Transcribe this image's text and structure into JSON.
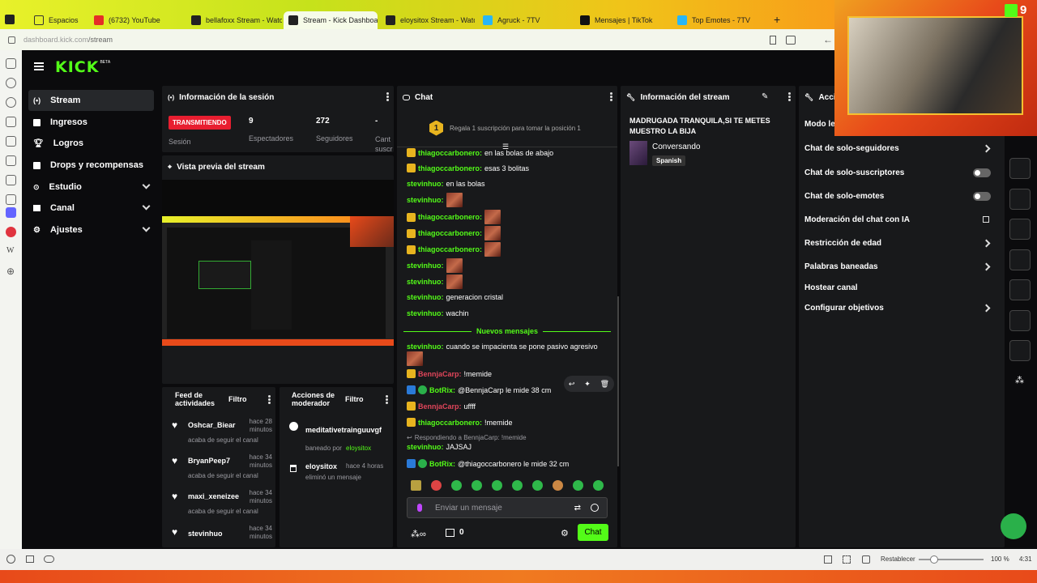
{
  "browser": {
    "tabs": [
      {
        "label": "Espacios"
      },
      {
        "label": "(6732) YouTube"
      },
      {
        "label": "bellafoxx Stream - Watch L"
      },
      {
        "label": "Stream - Kick Dashboard"
      },
      {
        "label": "eloysitox Stream - Watch L"
      },
      {
        "label": "Agruck - 7TV"
      },
      {
        "label": "Mensajes | TikTok"
      },
      {
        "label": "Top Emotes - 7TV"
      }
    ],
    "new_tab": "+",
    "url_domain": "dashboard.kick.com",
    "url_path": "/stream",
    "bottom": {
      "reset_label": "Restablecer",
      "zoom": "100 %",
      "time": "4:31"
    }
  },
  "logo": {
    "text": "KICK",
    "beta": "BETA"
  },
  "nav": [
    {
      "label": "Stream"
    },
    {
      "label": "Ingresos"
    },
    {
      "label": "Logros"
    },
    {
      "label": "Drops y recompensas"
    },
    {
      "label": "Estudio"
    },
    {
      "label": "Canal"
    },
    {
      "label": "Ajustes"
    }
  ],
  "session": {
    "title": "Información de la sesión",
    "status": "TRANSMITIENDO",
    "status_label": "Sesión",
    "viewers": "9",
    "viewers_label": "Espectadores",
    "followers": "272",
    "followers_label": "Seguidores",
    "subs": "-",
    "subs_label": "Cant suscr"
  },
  "preview": {
    "title": "Vista previa del stream"
  },
  "feed": {
    "title": "Feed de actividades",
    "filter": "Filtro",
    "items": [
      {
        "user": "Oshcar_Biear",
        "time": "hace 28 minutos",
        "action": "acaba de seguir el canal"
      },
      {
        "user": "BryanPeep7",
        "time": "hace 34 minutos",
        "action": "acaba de seguir el canal"
      },
      {
        "user": "maxi_xeneizee",
        "time": "hace 34 minutos",
        "action": "acaba de seguir el canal"
      },
      {
        "user": "stevinhuo",
        "time": "hace 34 minutos",
        "action": ""
      }
    ]
  },
  "modactions": {
    "title": "Acciones de moderador",
    "filter": "Filtro",
    "items": [
      {
        "user": "meditativetrainguuvgf",
        "time": "",
        "action": "baneado por",
        "by": "eloysitox"
      },
      {
        "user": "eloysitox",
        "time": "hace 4 horas",
        "action": "eliminó un mensaje",
        "by": ""
      }
    ]
  },
  "chat": {
    "title": "Chat",
    "goal_num": "1",
    "goal_text": "Regala 1 suscripción para tomar la posición 1",
    "messages": [
      {
        "user": "thiagoccarbonero:",
        "text": "en las bolas de abajo"
      },
      {
        "user": "thiagoccarbonero:",
        "text": "esas 3 bolitas"
      },
      {
        "user": "stevinhuo:",
        "text": "en las bolas"
      },
      {
        "user": "stevinhuo:",
        "text": ""
      },
      {
        "user": "thiagoccarbonero:",
        "text": ""
      },
      {
        "user": "thiagoccarbonero:",
        "text": ""
      },
      {
        "user": "thiagoccarbonero:",
        "text": ""
      },
      {
        "user": "stevinhuo:",
        "text": ""
      },
      {
        "user": "stevinhuo:",
        "text": ""
      },
      {
        "user": "stevinhuo:",
        "text": "generacion cristal"
      },
      {
        "user": "stevinhuo:",
        "text": "wachin"
      }
    ],
    "new_messages": "Nuevos mensajes",
    "messages2": [
      {
        "user": "stevinhuo:",
        "text": "cuando se impacienta se pone pasivo agresivo"
      },
      {
        "user": "BennjaCarp:",
        "text": "!memide"
      },
      {
        "user": "BotRix:",
        "text": "@BennjaCarp le mide 38 cm"
      },
      {
        "user": "BennjaCarp:",
        "text": "uffff"
      },
      {
        "user": "thiagoccarbonero:",
        "text": "!memide"
      },
      {
        "user": "stevinhuo:",
        "text": "JAJSAJ"
      },
      {
        "user": "BotRix:",
        "text": "@thiagoccarbonero le mide 32 cm"
      }
    ],
    "reply_note": "Respondiendo a BennjaCarp: !memide",
    "input_placeholder": "Enviar un mensaje",
    "count": "0",
    "send": "Chat"
  },
  "streaminfo": {
    "title": "Información del stream",
    "stream_title": "MADRUGADA TRANQUILA,SI TE METES MUESTRO LA BIJA",
    "category": "Conversando",
    "language": "Spanish"
  },
  "settings": {
    "title": "Acci",
    "mode": "Modo le",
    "rows": [
      {
        "label": "Chat de solo-seguidores"
      },
      {
        "label": "Chat de solo-suscriptores"
      },
      {
        "label": "Chat de solo-emotes"
      },
      {
        "label": "Moderación del chat con IA"
      },
      {
        "label": "Restricción de edad"
      },
      {
        "label": "Palabras baneadas"
      },
      {
        "label": "Hostear canal"
      },
      {
        "label": "Configurar objetivos"
      }
    ]
  },
  "overlay": {
    "badge": "9"
  },
  "colors": {
    "accent": "#53fc18",
    "live": "#e81e30",
    "panel": "#18191b"
  }
}
